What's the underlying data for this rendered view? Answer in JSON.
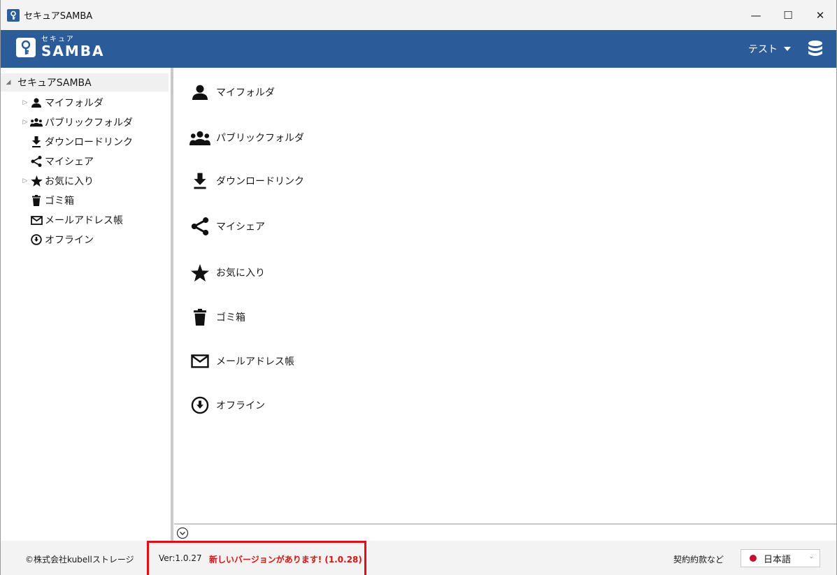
{
  "window": {
    "title": "セキュアSAMBA",
    "minimize": "—",
    "maximize": "☐",
    "close": "✕"
  },
  "header": {
    "logo_sub": "セキュア",
    "logo_main": "SAMBA",
    "user_label": "テスト",
    "accent_color": "#2b5c99"
  },
  "tree": {
    "root": "セキュアSAMBA",
    "items": [
      {
        "label": "マイフォルダ",
        "icon": "person-icon",
        "expandable": true
      },
      {
        "label": "パブリックフォルダ",
        "icon": "group-icon",
        "expandable": true
      },
      {
        "label": "ダウンロードリンク",
        "icon": "download-icon",
        "expandable": false
      },
      {
        "label": "マイシェア",
        "icon": "share-icon",
        "expandable": false
      },
      {
        "label": "お気に入り",
        "icon": "star-icon",
        "expandable": true
      },
      {
        "label": "ゴミ箱",
        "icon": "trash-icon",
        "expandable": false
      },
      {
        "label": "メールアドレス帳",
        "icon": "mail-icon",
        "expandable": false
      },
      {
        "label": "オフライン",
        "icon": "offline-icon",
        "expandable": false
      }
    ]
  },
  "main": {
    "items": [
      {
        "label": "マイフォルダ",
        "icon": "person-icon"
      },
      {
        "label": "パブリックフォルダ",
        "icon": "group-icon"
      },
      {
        "label": "ダウンロードリンク",
        "icon": "download-icon"
      },
      {
        "label": "マイシェア",
        "icon": "share-icon"
      },
      {
        "label": "お気に入り",
        "icon": "star-icon"
      },
      {
        "label": "ゴミ箱",
        "icon": "trash-icon"
      },
      {
        "label": "メールアドレス帳",
        "icon": "mail-icon"
      },
      {
        "label": "オフライン",
        "icon": "offline-icon"
      }
    ]
  },
  "status": {
    "copyright": "©株式会社kubellストレージ",
    "version": "Ver:1.0.27",
    "new_version": "新しいバージョンがあります! (1.0.28)",
    "terms": "契約約款など",
    "language": "日本語"
  }
}
